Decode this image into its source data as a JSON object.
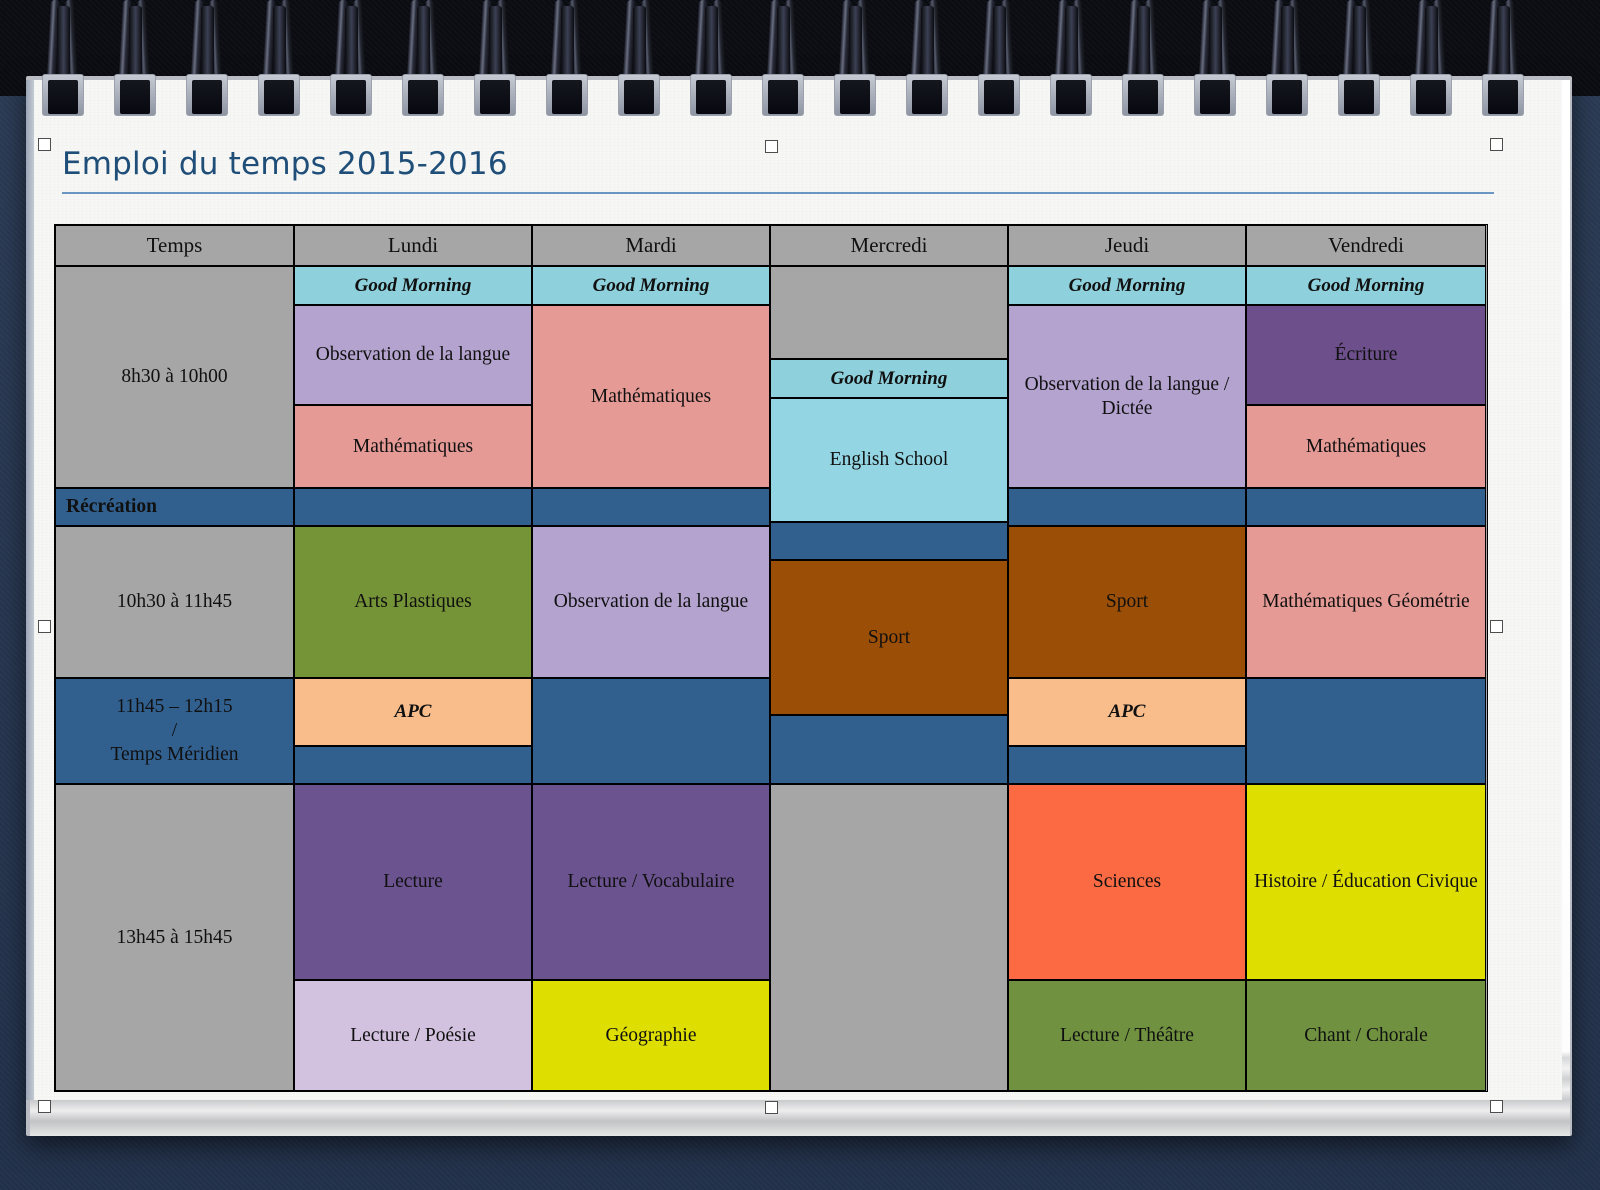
{
  "document": {
    "title": "Emploi du temps 2015-2016"
  },
  "table": {
    "columns": [
      "Temps",
      "Lundi",
      "Mardi",
      "Mercredi",
      "Jeudi",
      "Vendredi"
    ],
    "time_labels": {
      "morning": "8h30 à 10h00",
      "break": "Récréation",
      "midmorning": "10h30 à 11h45",
      "midday_line1": "11h45 – 12h15",
      "midday_line2": "/",
      "midday_line3": "Temps Méridien",
      "afternoon": "13h45 à 15h45"
    },
    "entries": {
      "good_morning": "Good Morning",
      "observation_langue": "Observation de la langue",
      "observation_langue_dictee": "Observation de la langue / Dictée",
      "mathematiques": "Mathématiques",
      "english_school": "English School",
      "ecriture": "Écriture",
      "arts_plastiques": "Arts Plastiques",
      "sport": "Sport",
      "mathematiques_geometrie": "Mathématiques Géométrie",
      "apc": "APC",
      "lecture": "Lecture",
      "lecture_vocabulaire": "Lecture / Vocabulaire",
      "sciences": "Sciences",
      "histoire_education_civique": "Histoire / Éducation Civique",
      "lecture_poesie": "Lecture / Poésie",
      "geographie": "Géographie",
      "lecture_theatre": "Lecture / Théâtre",
      "chant_chorale": "Chant / Chorale"
    }
  },
  "colors": {
    "grey": "#a6a6a6",
    "cyan": "#8ed1dd",
    "cyan_light": "#93d5e2",
    "light_purple": "#b3a3ce",
    "pink": "#e59a95",
    "dark_purple_block": "#6d4f8c",
    "blue_break": "#31608f",
    "green": "#759337",
    "brown": "#9b4e06",
    "peach": "#f8bd8b",
    "purple_lecture": "#6b5390",
    "lilac": "#d2c2e0",
    "yellow": "#dede00",
    "orange_red": "#fb6a43",
    "olive": "#6f9140",
    "title_blue": "#1f4e79",
    "rule_blue": "#6b96c4",
    "border": "#000000",
    "page": "#f7f7f5",
    "desk": "#24344d"
  }
}
